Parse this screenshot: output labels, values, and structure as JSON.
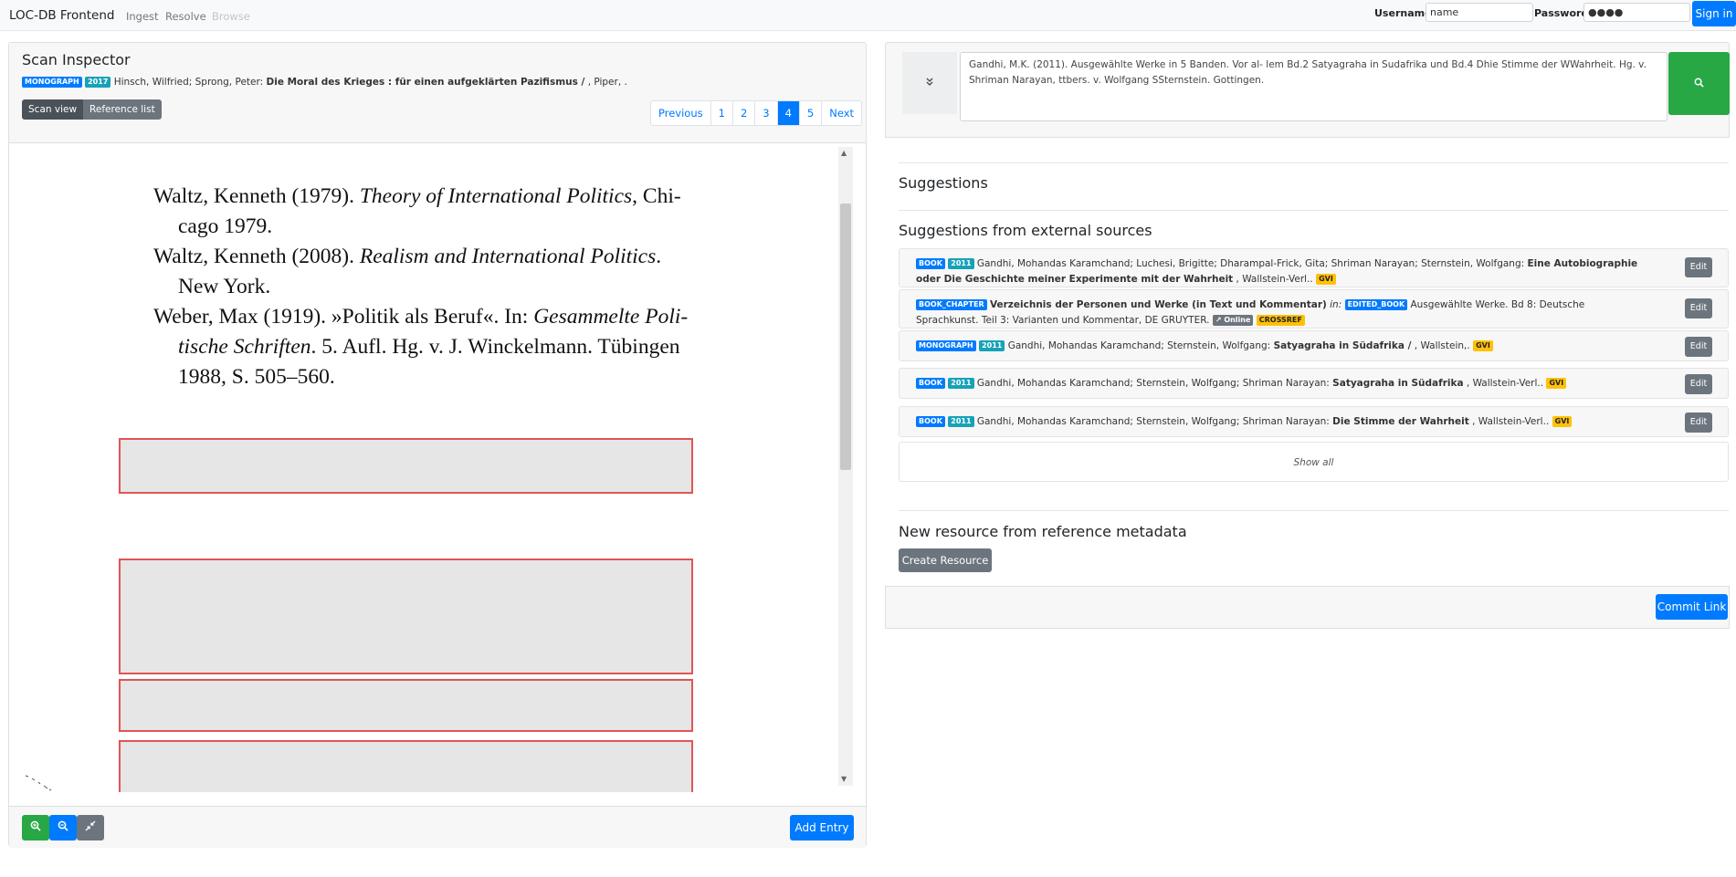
{
  "nav": {
    "brand": "LOC-DB Frontend",
    "links": [
      "Ingest",
      "Resolve",
      "Browse"
    ],
    "username_label": "Username:",
    "username_value": "name",
    "password_label": "Password:",
    "password_value": "●●●●",
    "signin_label": "Sign in"
  },
  "inspector": {
    "title": "Scan Inspector",
    "badge_type": "MONOGRAPH",
    "badge_year": "2017",
    "authors": "Hinsch, Wilfried; Sprong, Peter:",
    "work_title": "Die Moral des Krieges : für einen aufgeklärten Pazifismus /",
    "publisher": ", Piper, .",
    "view_scan": "Scan view",
    "view_list": "Reference list",
    "pagination": [
      "Previous",
      "1",
      "2",
      "3",
      "4",
      "5",
      "Next"
    ],
    "active_page": "4",
    "add_entry": "Add Entry"
  },
  "scan_text": {
    "l1a": "Waltz, Kenneth (1979). ",
    "l1b": "Theory of International Politics",
    "l1c": ", Chi-",
    "l2": "cago 1979.",
    "l3a": "Waltz, Kenneth (2008). ",
    "l3b": "Realism and International Politics",
    "l3c": ".",
    "l4": "New York.",
    "l5a": "Weber, Max (1919). »Politik als Beruf«. In: ",
    "l5b": "Gesammelte Poli-",
    "l6a": "tische Schriften",
    "l6b": ". 5. Aufl. Hg. v. J. Winckelmann. Tübingen",
    "l7": "1988, S. 505–560."
  },
  "resolve": {
    "reference_text": "Gandhi, M.K. (2011). Ausgewählte Werke in 5 Banden. Vor al- lem Bd.2 Satyagraha in Sudafrika und Bd.4 Dhie Stimme der WWahrheit. Hg. v. Shriman Narayan, ttbers. v. Wolfgang SSternstein. Gottingen.",
    "suggestions_title": "Suggestions",
    "external_title": "Suggestions from external sources",
    "edit_label": "Edit",
    "show_all": "Show all",
    "new_resource_title": "New resource from reference metadata",
    "create_resource": "Create Resource",
    "commit_link": "Commit Link"
  },
  "external_suggestions": [
    {
      "badge_type": "BOOK",
      "badge_year": "2011",
      "authors": "Gandhi, Mohandas Karamchand; Luchesi, Brigitte; Dharampal-Frick, Gita; Shriman Narayan; Sternstein, Wolfgang:",
      "title": "Eine Autobiographie oder Die Geschichte meiner Experimente mit der Wahrheit",
      "rest": ", Wallstein-Verl..",
      "source": "GVI"
    },
    {
      "badge_type": "BOOK_CHAPTER",
      "title": "Verzeichnis der Personen und Werke (in Text und Kommentar)",
      "in_label": "in:",
      "container_badge": "EDITED_BOOK",
      "rest": "Ausgewählte Werke. Bd 8: Deutsche Sprachkunst. Teil 3: Varianten und Kommentar, DE GRUYTER.",
      "online": "Online",
      "source": "CROSSREF"
    },
    {
      "badge_type": "MONOGRAPH",
      "badge_year": "2011",
      "authors": "Gandhi, Mohandas Karamchand; Sternstein, Wolfgang:",
      "title": "Satyagraha in Südafrika /",
      "rest": ", Wallstein,.",
      "source": "GVI"
    },
    {
      "badge_type": "BOOK",
      "badge_year": "2011",
      "authors": "Gandhi, Mohandas Karamchand; Sternstein, Wolfgang; Shriman Narayan:",
      "title": "Satyagraha in Südafrika",
      "rest": ", Wallstein-Verl..",
      "source": "GVI"
    },
    {
      "badge_type": "BOOK",
      "badge_year": "2011",
      "authors": "Gandhi, Mohandas Karamchand; Sternstein, Wolfgang; Shriman Narayan:",
      "title": "Die Stimme der Wahrheit",
      "rest": ", Wallstein-Verl..",
      "source": "GVI"
    }
  ],
  "icons": {
    "collapse": "chevron-double-down-icon",
    "search": "search-icon",
    "zoom_in": "zoom-in-icon",
    "zoom_out": "zoom-out-icon",
    "reset": "compress-icon",
    "external_link": "external-link-icon"
  },
  "colors": {
    "primary": "#007bff",
    "success": "#28a745",
    "secondary": "#6c757d",
    "info": "#17a2b8",
    "warning": "#ffc107",
    "region_border": "#e05555"
  }
}
